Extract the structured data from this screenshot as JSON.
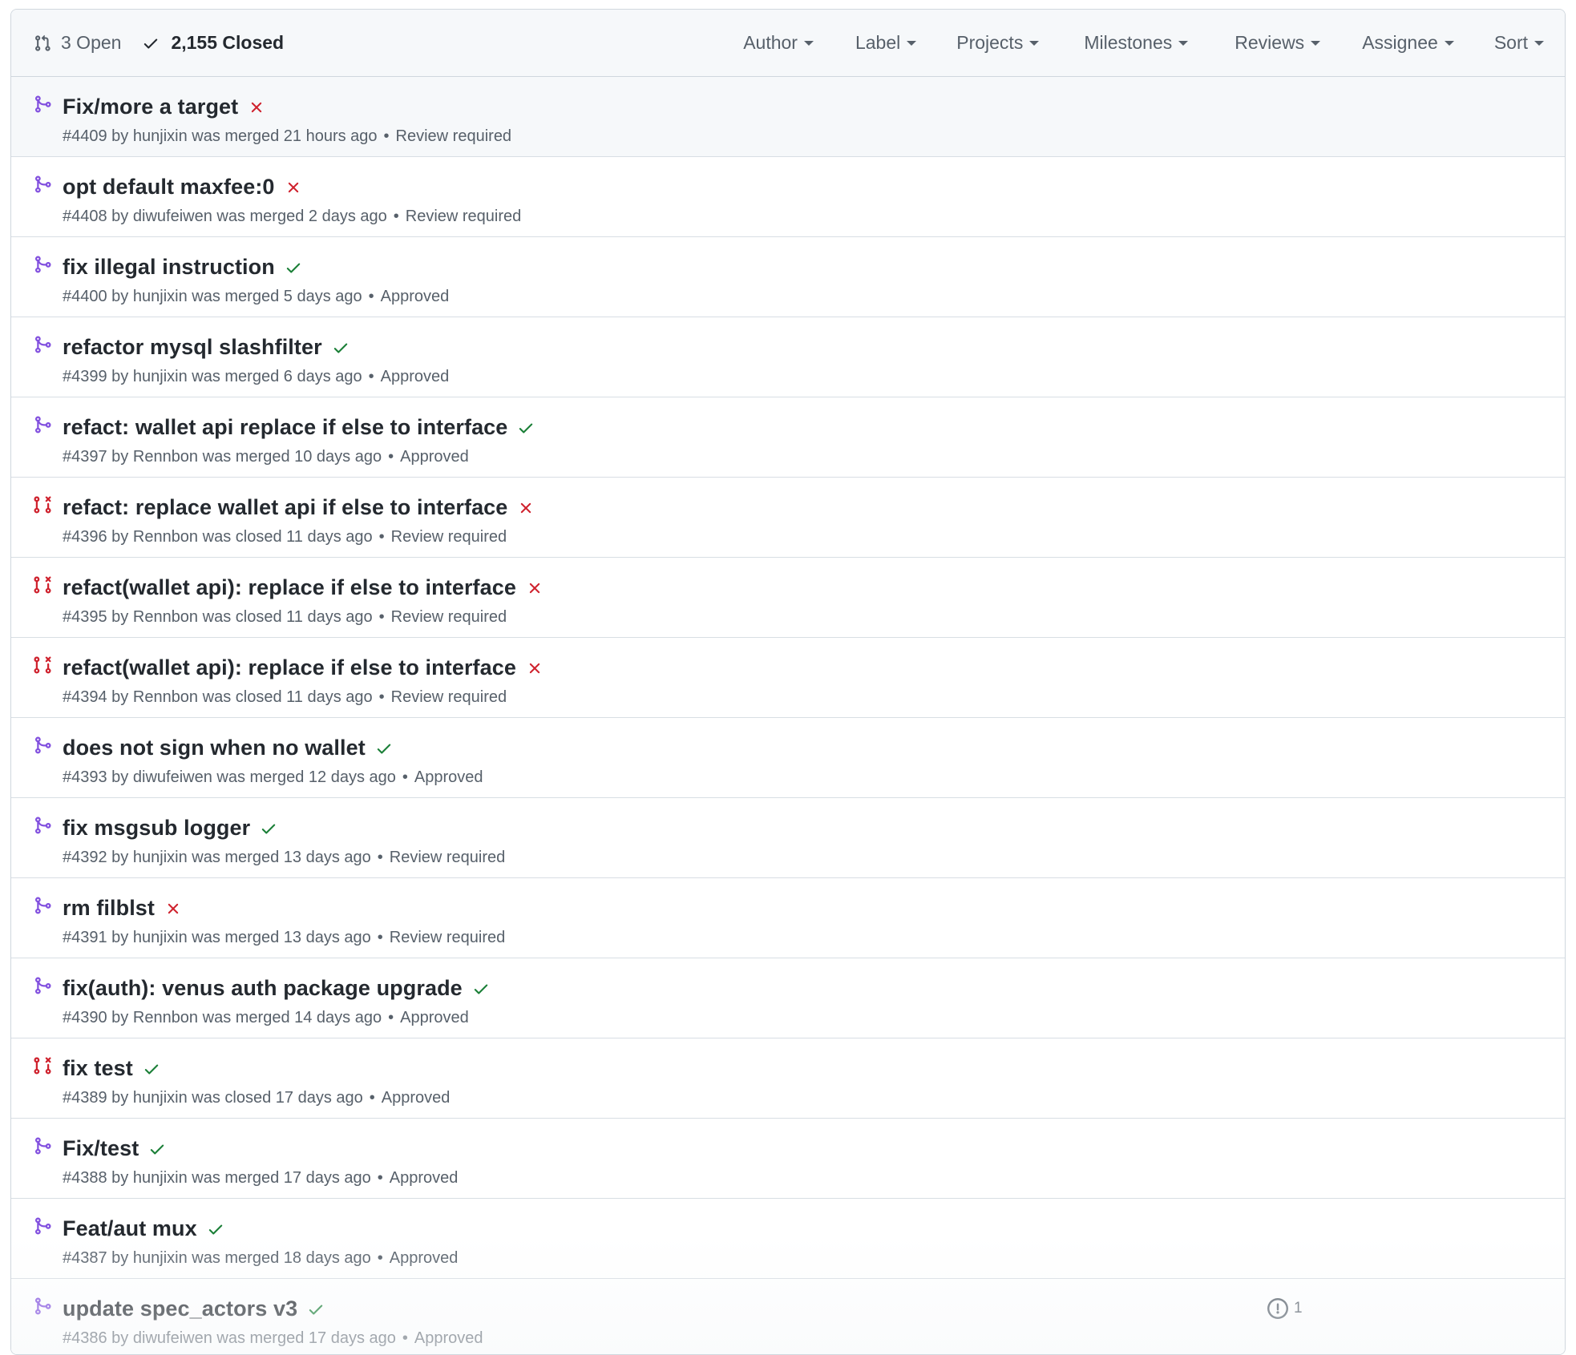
{
  "header": {
    "open_label": "3 Open",
    "closed_label": "2,155 Closed",
    "filters": [
      "Author",
      "Label",
      "Projects",
      "Milestones",
      "Reviews",
      "Assignee",
      "Sort"
    ]
  },
  "colors": {
    "merged": "#8250df",
    "closed": "#cf222e",
    "success": "#1a7f37",
    "failure": "#cf222e"
  },
  "pulls": [
    {
      "title": "Fix/more a target",
      "state": "merged",
      "check": "failure",
      "number": "#4409",
      "author": "hunjixin",
      "action": "was merged",
      "when": "21 hours ago",
      "review": "Review required",
      "hover": true
    },
    {
      "title": "opt default maxfee:0",
      "state": "merged",
      "check": "failure",
      "number": "#4408",
      "author": "diwufeiwen",
      "action": "was merged",
      "when": "2 days ago",
      "review": "Review required"
    },
    {
      "title": "fix illegal instruction",
      "state": "merged",
      "check": "success",
      "number": "#4400",
      "author": "hunjixin",
      "action": "was merged",
      "when": "5 days ago",
      "review": "Approved"
    },
    {
      "title": "refactor mysql slashfilter",
      "state": "merged",
      "check": "success",
      "number": "#4399",
      "author": "hunjixin",
      "action": "was merged",
      "when": "6 days ago",
      "review": "Approved"
    },
    {
      "title": "refact: wallet api replace if else to interface",
      "state": "merged",
      "check": "success",
      "number": "#4397",
      "author": "Rennbon",
      "action": "was merged",
      "when": "10 days ago",
      "review": "Approved"
    },
    {
      "title": "refact: replace wallet api if else to interface",
      "state": "closed",
      "check": "failure",
      "number": "#4396",
      "author": "Rennbon",
      "action": "was closed",
      "when": "11 days ago",
      "review": "Review required"
    },
    {
      "title": "refact(wallet api): replace if else to interface",
      "state": "closed",
      "check": "failure",
      "number": "#4395",
      "author": "Rennbon",
      "action": "was closed",
      "when": "11 days ago",
      "review": "Review required"
    },
    {
      "title": "refact(wallet api): replace if else to interface",
      "state": "closed",
      "check": "failure",
      "number": "#4394",
      "author": "Rennbon",
      "action": "was closed",
      "when": "11 days ago",
      "review": "Review required"
    },
    {
      "title": "does not sign when no wallet",
      "state": "merged",
      "check": "success",
      "number": "#4393",
      "author": "diwufeiwen",
      "action": "was merged",
      "when": "12 days ago",
      "review": "Approved"
    },
    {
      "title": "fix msgsub logger",
      "state": "merged",
      "check": "success",
      "number": "#4392",
      "author": "hunjixin",
      "action": "was merged",
      "when": "13 days ago",
      "review": "Review required"
    },
    {
      "title": "rm filblst",
      "state": "merged",
      "check": "failure",
      "number": "#4391",
      "author": "hunjixin",
      "action": "was merged",
      "when": "13 days ago",
      "review": "Review required"
    },
    {
      "title": "fix(auth): venus auth package upgrade",
      "state": "merged",
      "check": "success",
      "number": "#4390",
      "author": "Rennbon",
      "action": "was merged",
      "when": "14 days ago",
      "review": "Approved"
    },
    {
      "title": "fix test",
      "state": "closed",
      "check": "success",
      "number": "#4389",
      "author": "hunjixin",
      "action": "was closed",
      "when": "17 days ago",
      "review": "Approved"
    },
    {
      "title": "Fix/test",
      "state": "merged",
      "check": "success",
      "number": "#4388",
      "author": "hunjixin",
      "action": "was merged",
      "when": "17 days ago",
      "review": "Approved"
    },
    {
      "title": "Feat/aut mux",
      "state": "merged",
      "check": "success",
      "number": "#4387",
      "author": "hunjixin",
      "action": "was merged",
      "when": "18 days ago",
      "review": "Approved"
    },
    {
      "title": "update spec_actors v3",
      "state": "merged",
      "check": "success",
      "number": "#4386",
      "author": "diwufeiwen",
      "action": "was merged",
      "when": "17 days ago",
      "review": "Approved",
      "comments": "1"
    }
  ]
}
